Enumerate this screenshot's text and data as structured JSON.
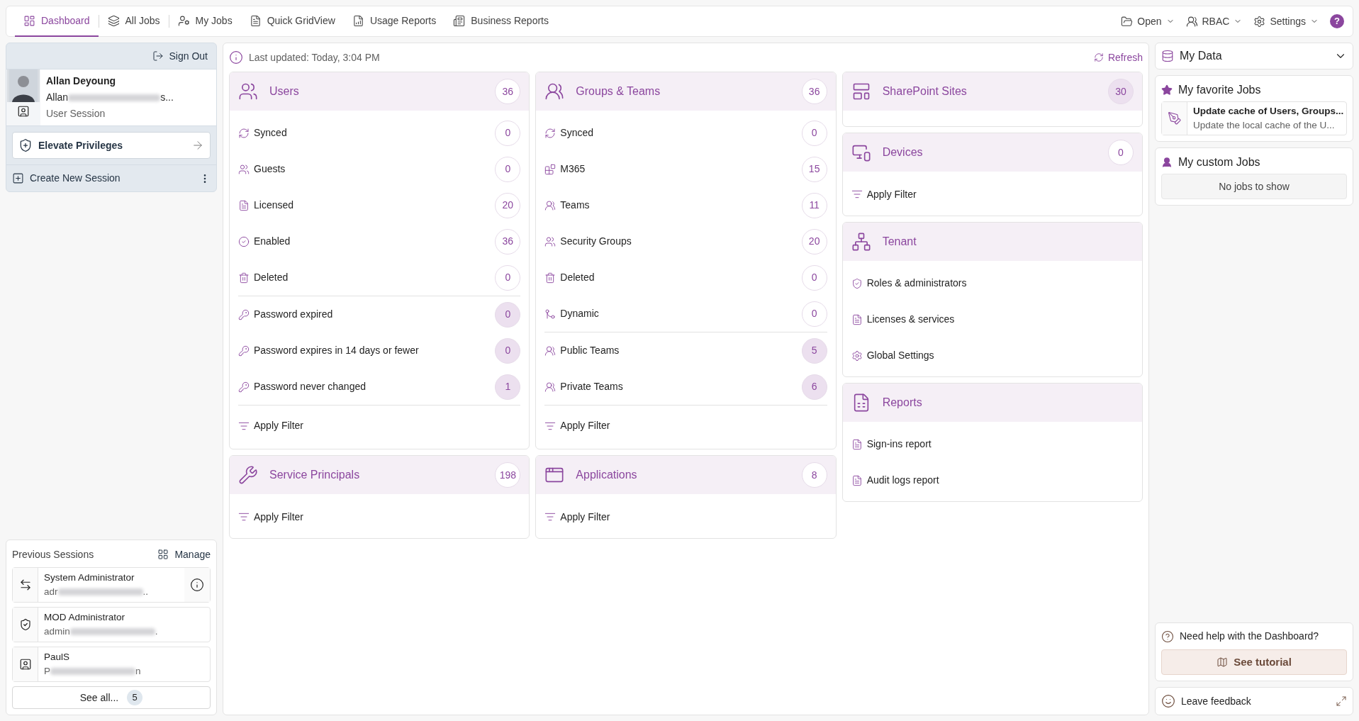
{
  "nav": {
    "tabs": [
      {
        "label": "Dashboard",
        "selected": true
      },
      {
        "label": "All Jobs",
        "selected": false
      },
      {
        "label": "My Jobs",
        "selected": false
      },
      {
        "label": "Quick GridView",
        "selected": false
      },
      {
        "label": "Usage Reports",
        "selected": false
      },
      {
        "label": "Business Reports",
        "selected": false
      }
    ],
    "menus": [
      "Open",
      "RBAC",
      "Settings"
    ],
    "help": "?"
  },
  "session": {
    "sign_out": "Sign Out",
    "name": "Allan Deyoung",
    "account_start": "Allan",
    "account_end": "s...",
    "type": "User Session",
    "elevate": "Elevate Privileges",
    "create": "Create New Session"
  },
  "previous_sessions": {
    "title": "Previous Sessions",
    "manage": "Manage",
    "items": [
      {
        "name": "System Administrator",
        "account_start": "adr",
        "account_end": "..",
        "info": true
      },
      {
        "name": "MOD Administrator",
        "account_start": "admin",
        "account_end": ".",
        "info": false
      },
      {
        "name": "PaulS",
        "account_start": "P",
        "account_end": "n",
        "info": false
      }
    ],
    "see_all": "See all...",
    "count": "5"
  },
  "status": {
    "last_updated": "Last updated: Today, 3:04 PM",
    "refresh": "Refresh"
  },
  "columns": [
    [
      {
        "title": "Users",
        "count": "36",
        "emphasized": false,
        "sections": [
          [
            {
              "label": "Synced",
              "count": "0",
              "emphasized": false
            },
            {
              "label": "Guests",
              "count": "0",
              "emphasized": false
            },
            {
              "label": "Licensed",
              "count": "20",
              "emphasized": false
            },
            {
              "label": "Enabled",
              "count": "36",
              "emphasized": false
            },
            {
              "label": "Deleted",
              "count": "0",
              "emphasized": false
            }
          ],
          [
            {
              "label": "Password expired",
              "count": "0",
              "emphasized": true
            },
            {
              "label": "Password expires in 14 days or fewer",
              "count": "0",
              "emphasized": true
            },
            {
              "label": "Password never changed",
              "count": "1",
              "emphasized": true
            }
          ]
        ],
        "filter": "Apply Filter"
      },
      {
        "title": "Service Principals",
        "count": "198",
        "emphasized": false,
        "filter": "Apply Filter"
      }
    ],
    [
      {
        "title": "Groups & Teams",
        "count": "36",
        "emphasized": false,
        "sections": [
          [
            {
              "label": "Synced",
              "count": "0",
              "emphasized": false
            },
            {
              "label": "M365",
              "count": "15",
              "emphasized": false
            },
            {
              "label": "Teams",
              "count": "11",
              "emphasized": false
            },
            {
              "label": "Security Groups",
              "count": "20",
              "emphasized": false
            },
            {
              "label": "Deleted",
              "count": "0",
              "emphasized": false
            },
            {
              "label": "Dynamic",
              "count": "0",
              "emphasized": false
            }
          ],
          [
            {
              "label": "Public Teams",
              "count": "5",
              "emphasized": true
            },
            {
              "label": "Private Teams",
              "count": "6",
              "emphasized": true
            }
          ]
        ],
        "filter": "Apply Filter"
      },
      {
        "title": "Applications",
        "count": "8",
        "emphasized": false,
        "filter": "Apply Filter"
      }
    ],
    [
      {
        "title": "SharePoint Sites",
        "count": "30",
        "emphasized": true
      },
      {
        "title": "Devices",
        "count": "0",
        "emphasized": false,
        "filter": "Apply Filter"
      },
      {
        "title": "Tenant",
        "sections": [
          [
            {
              "label": "Roles & administrators"
            },
            {
              "label": "Licenses & services"
            },
            {
              "label": "Global Settings"
            }
          ]
        ]
      },
      {
        "title": "Reports",
        "sections": [
          [
            {
              "label": "Sign-ins report"
            },
            {
              "label": "Audit logs report"
            }
          ]
        ]
      }
    ]
  ],
  "side": {
    "my_data": "My Data",
    "favorites": {
      "title": "My favorite Jobs",
      "jobs": [
        {
          "title": "Update cache of Users, Groups...",
          "description": "Update the local cache of the U..."
        }
      ]
    },
    "custom": {
      "title": "My custom Jobs",
      "empty": "No jobs to show"
    },
    "help": {
      "question": "Need help with the Dashboard?",
      "button": "See tutorial"
    },
    "feedback": "Leave feedback"
  }
}
